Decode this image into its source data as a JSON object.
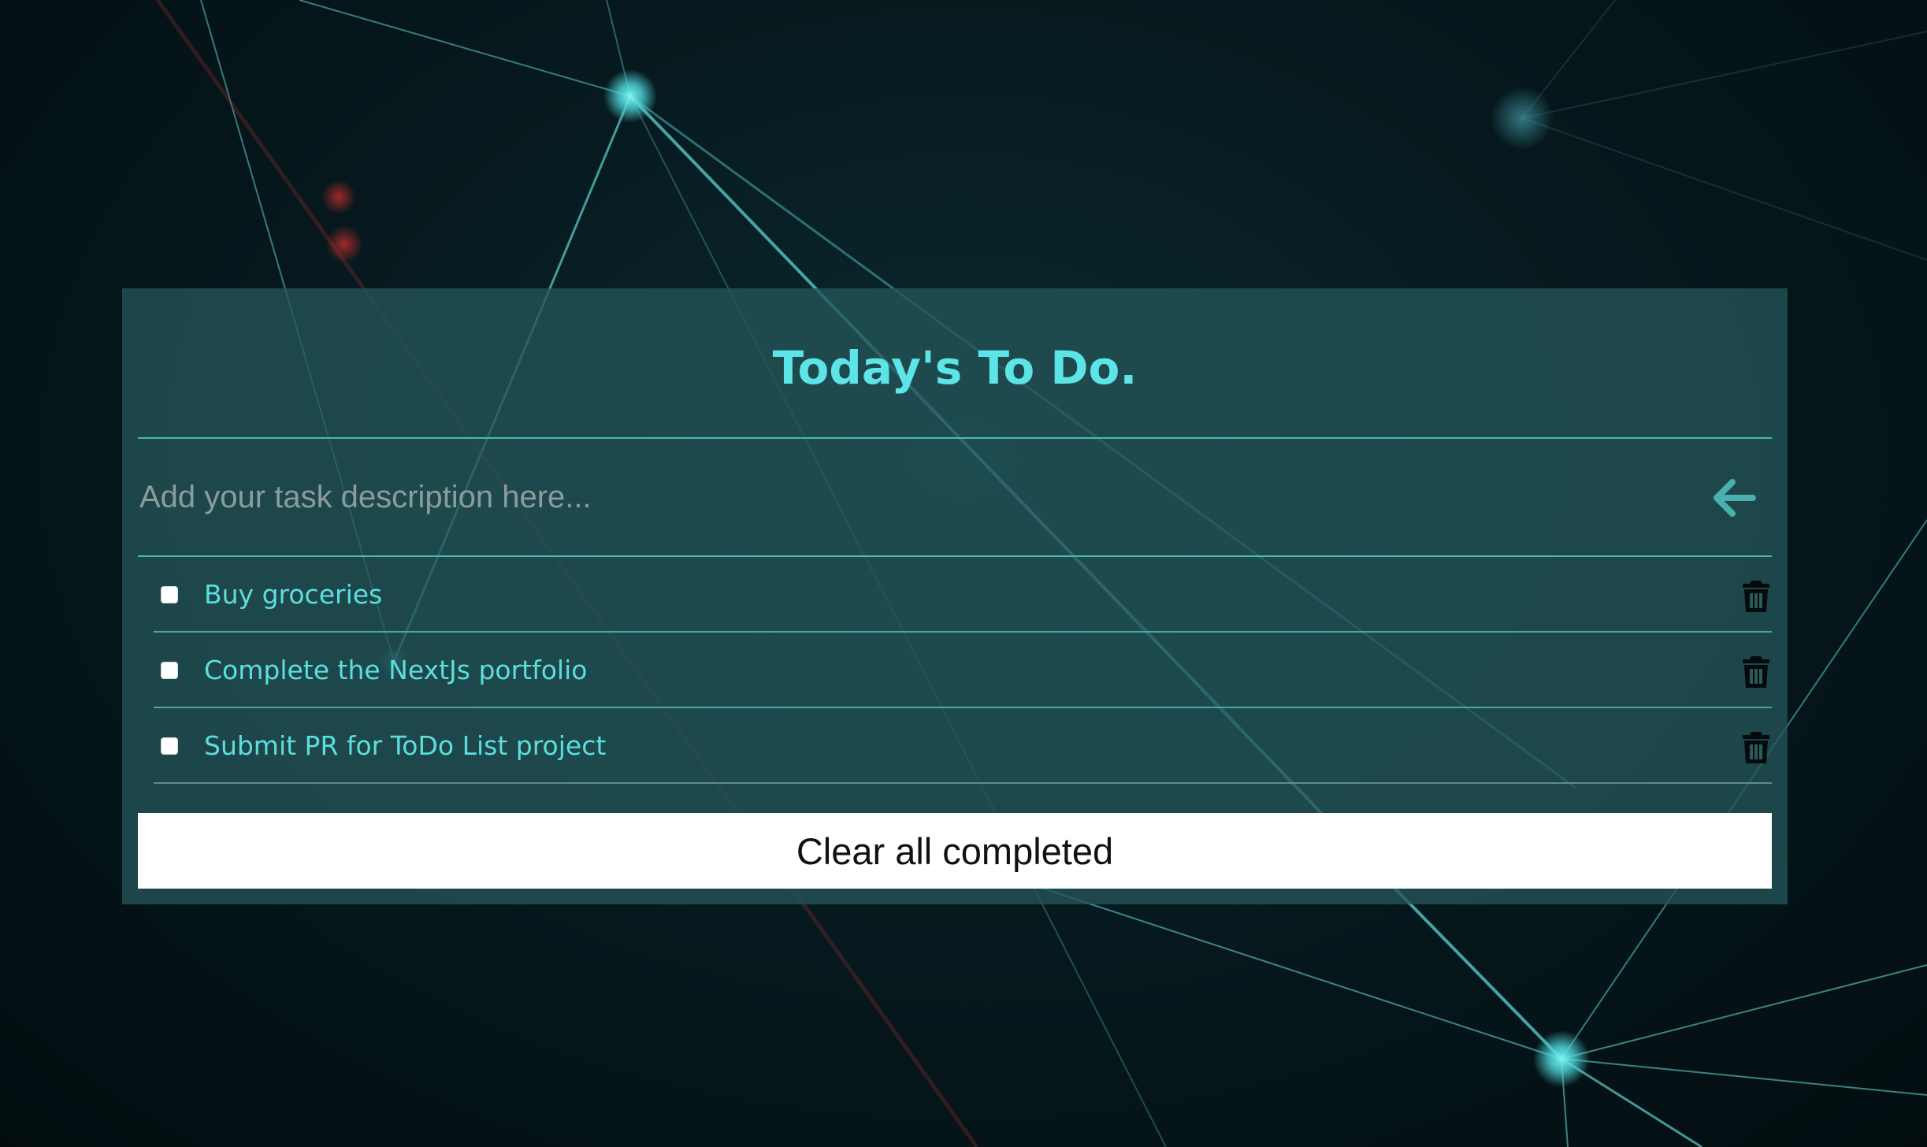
{
  "header": {
    "title": "Today's To Do."
  },
  "new_task": {
    "placeholder": "Add your task description here...",
    "value": ""
  },
  "tasks": [
    {
      "label": "Buy groceries",
      "completed": false
    },
    {
      "label": "Complete the NextJs portfolio",
      "completed": false
    },
    {
      "label": "Submit PR for ToDo List project",
      "completed": false
    }
  ],
  "footer": {
    "clear_label": "Clear all completed"
  },
  "icons": {
    "submit": "arrow-left-icon",
    "delete": "trash-icon"
  },
  "colors": {
    "accent": "#5de4e6",
    "card_bg": "#245458",
    "divider": "#4bb8b3",
    "button_bg": "#ffffff"
  }
}
